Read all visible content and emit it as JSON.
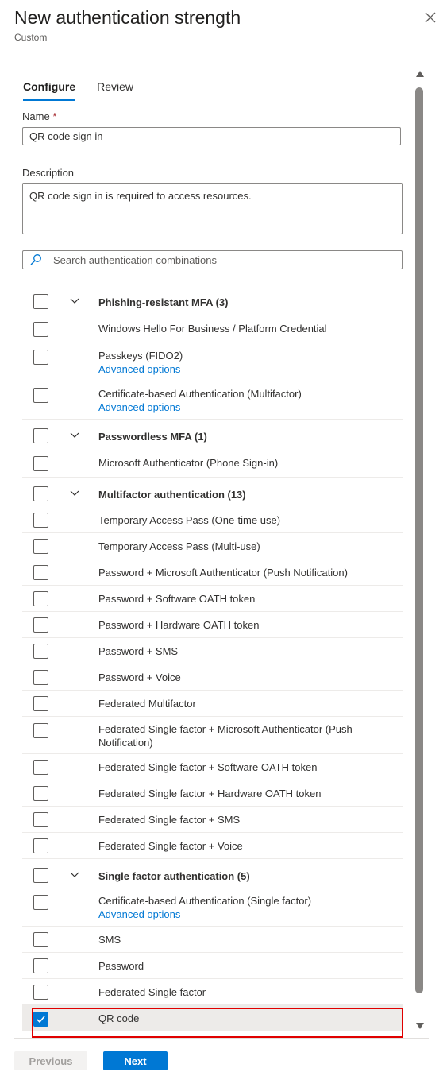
{
  "header": {
    "title": "New authentication strength",
    "subtitle": "Custom"
  },
  "tabs": [
    {
      "label": "Configure",
      "active": true
    },
    {
      "label": "Review",
      "active": false
    }
  ],
  "form": {
    "name_label": "Name",
    "required_mark": "*",
    "name_value": "QR code sign in",
    "description_label": "Description",
    "description_value": "QR code sign in is required to access resources.",
    "search_placeholder": "Search authentication combinations"
  },
  "groups": {
    "phishing": {
      "label": "Phishing-resistant MFA (3)"
    },
    "passwordless": {
      "label": "Passwordless MFA (1)"
    },
    "multifactor": {
      "label": "Multifactor authentication (13)"
    },
    "single": {
      "label": "Single factor authentication (5)"
    }
  },
  "items": {
    "whfb": "Windows Hello For Business / Platform Credential",
    "passkeys": "Passkeys (FIDO2)",
    "cba_multi": "Certificate-based Authentication (Multifactor)",
    "ms_auth_phone": "Microsoft Authenticator (Phone Sign-in)",
    "tap_once": "Temporary Access Pass (One-time use)",
    "tap_multi": "Temporary Access Pass (Multi-use)",
    "pwd_ms_auth": "Password + Microsoft Authenticator (Push Notification)",
    "pwd_sw_oath": "Password + Software OATH token",
    "pwd_hw_oath": "Password + Hardware OATH token",
    "pwd_sms": "Password + SMS",
    "pwd_voice": "Password + Voice",
    "fed_mfa": "Federated Multifactor",
    "fed_sf_ms_auth": "Federated Single factor + Microsoft Authenticator (Push Notification)",
    "fed_sf_sw_oath": "Federated Single factor + Software OATH token",
    "fed_sf_hw_oath": "Federated Single factor + Hardware OATH token",
    "fed_sf_sms": "Federated Single factor + SMS",
    "fed_sf_voice": "Federated Single factor + Voice",
    "cba_single": "Certificate-based Authentication (Single factor)",
    "sms": "SMS",
    "password": "Password",
    "fed_sf": "Federated Single factor",
    "qr_code": "QR code",
    "advanced_options": "Advanced options"
  },
  "selected_item": "QR code",
  "footer": {
    "previous_label": "Previous",
    "next_label": "Next"
  },
  "colors": {
    "accent": "#0078d4",
    "highlight": "#e00000"
  }
}
